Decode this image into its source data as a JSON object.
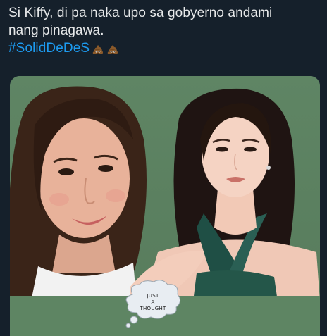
{
  "tweet": {
    "line1": "Si Kiffy, di pa naka upo sa gobyerno andami",
    "line2": "nang pinagawa.",
    "hashtag": "#SolidDeDeS",
    "emojis": [
      "pile-of-poo",
      "pile-of-poo"
    ]
  },
  "media": {
    "bubble_lines": [
      "JUST",
      "A",
      "THOUGHT"
    ]
  },
  "colors": {
    "background": "#15202b",
    "text": "#e7e9ea",
    "hashtag": "#1d9bf0",
    "media_background": "#5d8262"
  }
}
